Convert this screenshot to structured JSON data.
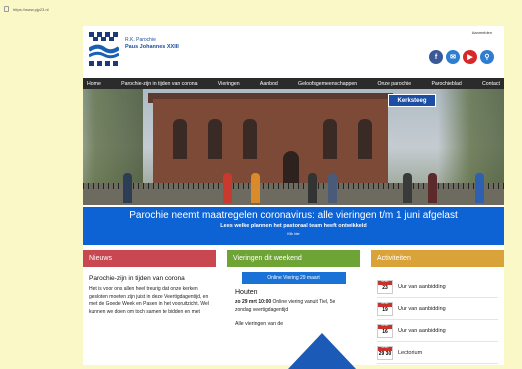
{
  "browser": {
    "url": "https://www.pjp23.nl"
  },
  "header": {
    "logo_line1": "R.K. Parochie",
    "logo_line2": "Paus Johannes XXIII",
    "login": "Aanmelden",
    "socials": [
      {
        "name": "facebook-icon",
        "glyph": "f",
        "color": "#3b5998"
      },
      {
        "name": "mail-icon",
        "glyph": "✉",
        "color": "#2f7dd1"
      },
      {
        "name": "youtube-icon",
        "glyph": "▶",
        "color": "#d62a2a"
      },
      {
        "name": "search-icon",
        "glyph": "⚲",
        "color": "#2f7dd1"
      }
    ]
  },
  "nav": {
    "items": [
      "Home",
      "Parochie-zijn in tijden van corona",
      "Vieringen",
      "Aanbod",
      "Geloofsgemeenschappen",
      "Onze parochie",
      "Parochieblad",
      "Contact"
    ]
  },
  "hero": {
    "street_sign": "Kerksteeg"
  },
  "banner": {
    "headline": "Parochie neemt maatregelen coronavirus: alle vieringen t/m 1 juni afgelast",
    "subline": "Lees welke plannen het pastoraal team heeft ontwikkeld",
    "more": "Klik hier"
  },
  "nieuws": {
    "heading": "Nieuws",
    "title": "Parochie-zijn in tijden van corona",
    "text": "Het is voor ons allen heel treurig dat onze kerken gesloten moeten zijn juist in deze Veertigdagentijd, en met de Goede Week en Pasen in het vooruitzicht. Wel kunnen we doen om toch samen te bidden en met"
  },
  "vieringen": {
    "heading": "Vieringen dit weekend",
    "button": "Online Viering 29 maart",
    "place": "Houten",
    "text_bold": "zo 29 mrt 10:00",
    "text": " Online viering vanuit Tiel, 5e zondag veertigdagentijd",
    "all": "Alle vieringen van de"
  },
  "activiteiten": {
    "heading": "Activiteiten",
    "items": [
      {
        "month": "APRIL",
        "day": "23",
        "label": "Uur van aanbidding"
      },
      {
        "month": "APRIL",
        "day": "19",
        "label": "Uur van aanbidding"
      },
      {
        "month": "APRIL",
        "day": "16",
        "label": "Uur van aanbidding"
      },
      {
        "month": "APRIL",
        "day": "29 30",
        "label": "Lectorium"
      }
    ]
  }
}
